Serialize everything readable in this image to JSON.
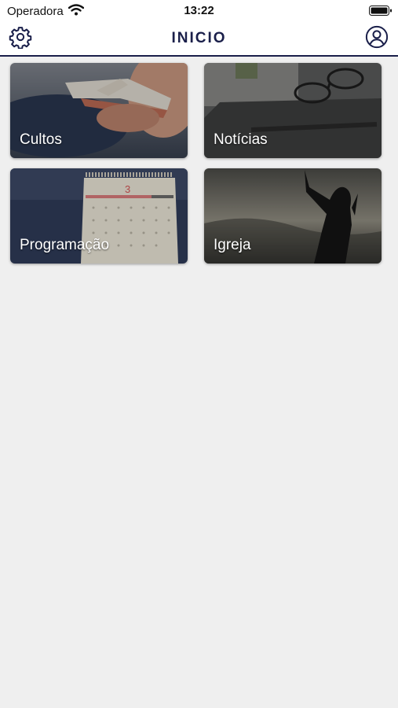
{
  "status": {
    "carrier": "Operadora",
    "time": "13:22"
  },
  "header": {
    "title": "INICIO"
  },
  "cards": [
    {
      "label": "Cultos"
    },
    {
      "label": "Notícias"
    },
    {
      "label": "Programação",
      "calendar_day": "3"
    },
    {
      "label": "Igreja"
    }
  ],
  "colors": {
    "accent": "#1a1f4a",
    "background": "#efefef"
  }
}
